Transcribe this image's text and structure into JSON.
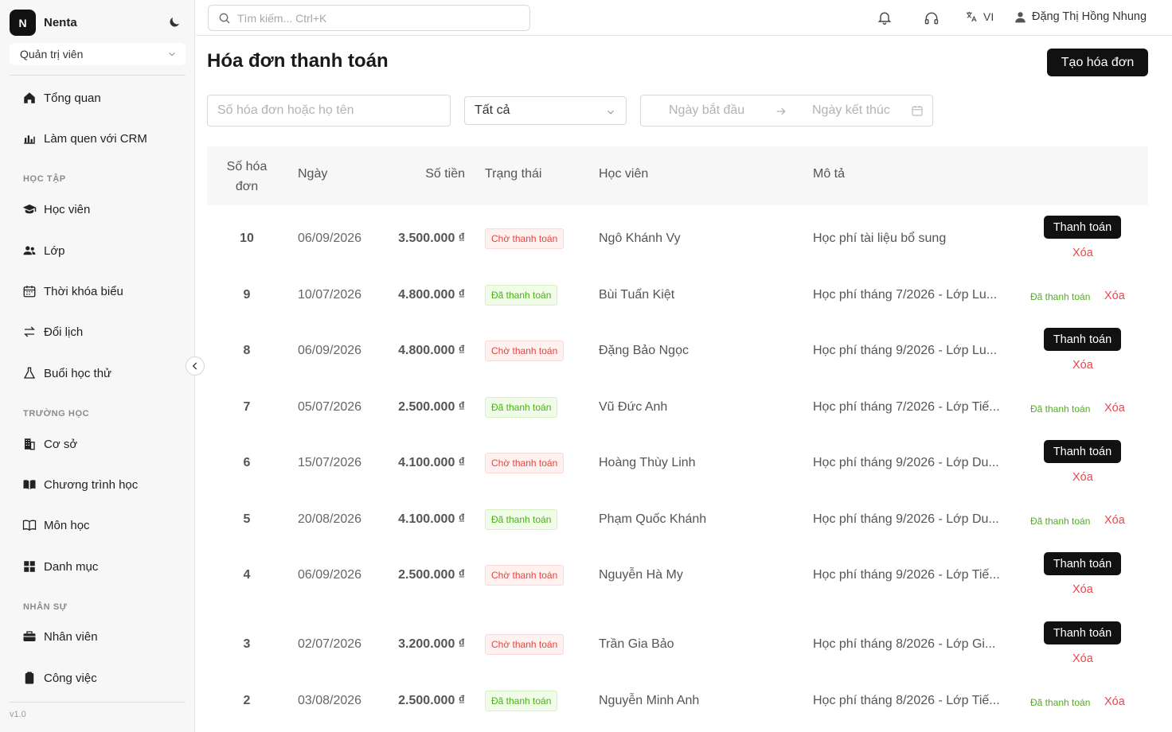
{
  "brand": {
    "logo": "N",
    "name": "Nenta"
  },
  "role": "Quản trị viên",
  "nav": {
    "main": [
      {
        "label": "Tổng quan",
        "icon": "home-icon"
      },
      {
        "label": "Làm quen với CRM",
        "icon": "chart-icon"
      }
    ],
    "sections": [
      {
        "title": "HỌC TẬP",
        "items": [
          {
            "label": "Học viên",
            "icon": "graduation-cap-icon"
          },
          {
            "label": "Lớp",
            "icon": "users-icon"
          },
          {
            "label": "Thời khóa biểu",
            "icon": "calendar-icon"
          },
          {
            "label": "Đổi lịch",
            "icon": "swap-icon"
          },
          {
            "label": "Buổi học thử",
            "icon": "flask-icon"
          }
        ]
      },
      {
        "title": "TRƯỜNG HỌC",
        "items": [
          {
            "label": "Cơ sở",
            "icon": "building-icon"
          },
          {
            "label": "Chương trình học",
            "icon": "book-filled-icon"
          },
          {
            "label": "Môn học",
            "icon": "book-open-icon"
          },
          {
            "label": "Danh mục",
            "icon": "grid-icon"
          }
        ]
      },
      {
        "title": "NHÂN SỰ",
        "items": [
          {
            "label": "Nhân viên",
            "icon": "briefcase-icon"
          },
          {
            "label": "Công việc",
            "icon": "clipboard-icon"
          }
        ]
      }
    ]
  },
  "version": "v1.0",
  "topbar": {
    "search_placeholder": "Tìm kiếm... Ctrl+K",
    "language": "VI",
    "user_name": "Đặng Thị Hồng Nhung"
  },
  "page": {
    "title": "Hóa đơn thanh toán",
    "create_button": "Tạo hóa đơn"
  },
  "filters": {
    "search_placeholder": "Số hóa đơn hoặc họ tên",
    "status_value": "Tất cả",
    "start_date_placeholder": "Ngày bắt đầu",
    "end_date_placeholder": "Ngày kết thúc"
  },
  "table": {
    "headers": {
      "number_line1": "Số hóa",
      "number_line2": "đơn",
      "date": "Ngày",
      "amount": "Số tiền",
      "status": "Trạng thái",
      "student": "Học viên",
      "description": "Mô tả"
    },
    "actions": {
      "pay": "Thanh toán",
      "delete": "Xóa",
      "paid": "Đã thanh toán"
    },
    "rows": [
      {
        "number": "10",
        "date": "06/09/2026",
        "amount": "3.500.000 ₫",
        "status": "Chờ thanh toán",
        "status_type": "pending",
        "student": "Ngô Khánh Vy",
        "description": "Học phí tài liệu bổ sung"
      },
      {
        "number": "9",
        "date": "10/07/2026",
        "amount": "4.800.000 ₫",
        "status": "Đã thanh toán",
        "status_type": "paid",
        "student": "Bùi Tuấn Kiệt",
        "description": "Học phí tháng 7/2026 - Lớp Lu..."
      },
      {
        "number": "8",
        "date": "06/09/2026",
        "amount": "4.800.000 ₫",
        "status": "Chờ thanh toán",
        "status_type": "pending",
        "student": "Đặng Bảo Ngọc",
        "description": "Học phí tháng 9/2026 - Lớp Lu..."
      },
      {
        "number": "7",
        "date": "05/07/2026",
        "amount": "2.500.000 ₫",
        "status": "Đã thanh toán",
        "status_type": "paid",
        "student": "Vũ Đức Anh",
        "description": "Học phí tháng 7/2026 - Lớp Tiế..."
      },
      {
        "number": "6",
        "date": "15/07/2026",
        "amount": "4.100.000 ₫",
        "status": "Chờ thanh toán",
        "status_type": "pending",
        "student": "Hoàng Thùy Linh",
        "description": "Học phí tháng 9/2026 - Lớp Du..."
      },
      {
        "number": "5",
        "date": "20/08/2026",
        "amount": "4.100.000 ₫",
        "status": "Đã thanh toán",
        "status_type": "paid",
        "student": "Phạm Quốc Khánh",
        "description": "Học phí tháng 9/2026 - Lớp Du..."
      },
      {
        "number": "4",
        "date": "06/09/2026",
        "amount": "2.500.000 ₫",
        "status": "Chờ thanh toán",
        "status_type": "pending",
        "student": "Nguyễn Hà My",
        "description": "Học phí tháng 9/2026 - Lớp Tiế..."
      },
      {
        "number": "3",
        "date": "02/07/2026",
        "amount": "3.200.000 ₫",
        "status": "Chờ thanh toán",
        "status_type": "pending",
        "student": "Trần Gia Bảo",
        "description": "Học phí tháng 8/2026 - Lớp Gi..."
      },
      {
        "number": "2",
        "date": "03/08/2026",
        "amount": "2.500.000 ₫",
        "status": "Đã thanh toán",
        "status_type": "paid",
        "student": "Nguyễn Minh Anh",
        "description": "Học phí tháng 8/2026 - Lớp Tiế..."
      }
    ]
  }
}
